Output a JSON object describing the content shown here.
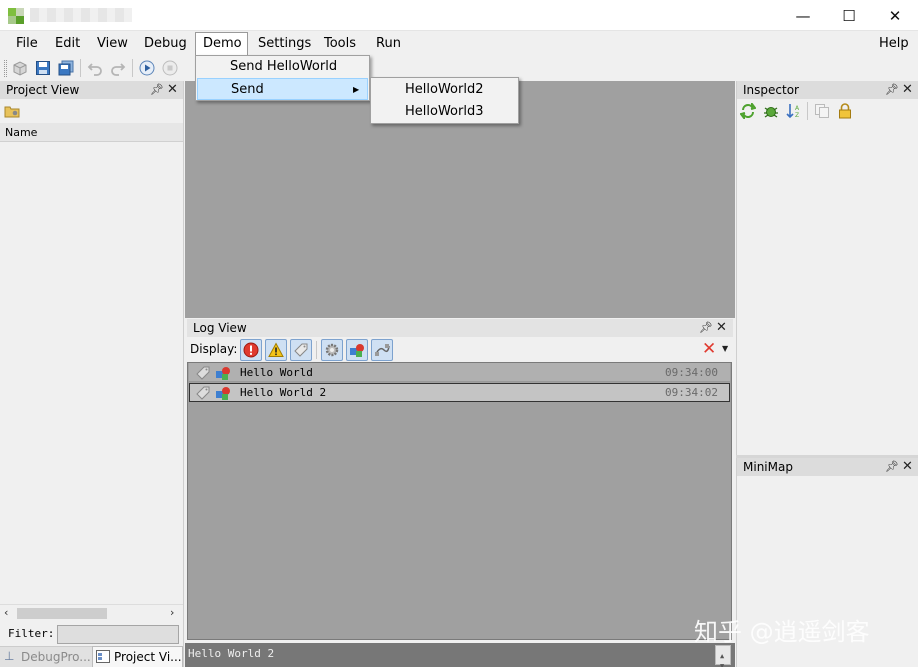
{
  "window": {
    "controls": {
      "minimize": "—",
      "maximize": "☐",
      "close": "✕"
    }
  },
  "menubar": {
    "items": [
      "File",
      "Edit",
      "View",
      "Debug",
      "Demo",
      "Settings",
      "Tools",
      "Run"
    ],
    "help": "Help"
  },
  "demo_menu": {
    "items": [
      "Send HelloWorld",
      "Send"
    ],
    "send_submenu": [
      "HelloWorld2",
      "HelloWorld3"
    ]
  },
  "project_view": {
    "title": "Project View",
    "column_header": "Name",
    "filter_label": "Filter:",
    "filter_value": "",
    "bottom_tabs": [
      "DebugPro...",
      "Project Vi..."
    ]
  },
  "log_view": {
    "title": "Log View",
    "display_label": "Display:",
    "rows": [
      {
        "message": "Hello World",
        "time": "09:34:00"
      },
      {
        "message": "Hello World 2",
        "time": "09:34:02"
      }
    ],
    "status_line": "Hello World 2"
  },
  "inspector": {
    "title": "Inspector"
  },
  "minimap": {
    "title": "MiniMap"
  },
  "watermark": "知乎 @逍遥剑客",
  "colors": {
    "menu_highlight": "#cce8ff",
    "workspace_bg": "#a0a0a0",
    "display_btn_bg": "#cfe0f3",
    "error_red": "#e03a2f",
    "warning_yellow": "#f3c318"
  }
}
